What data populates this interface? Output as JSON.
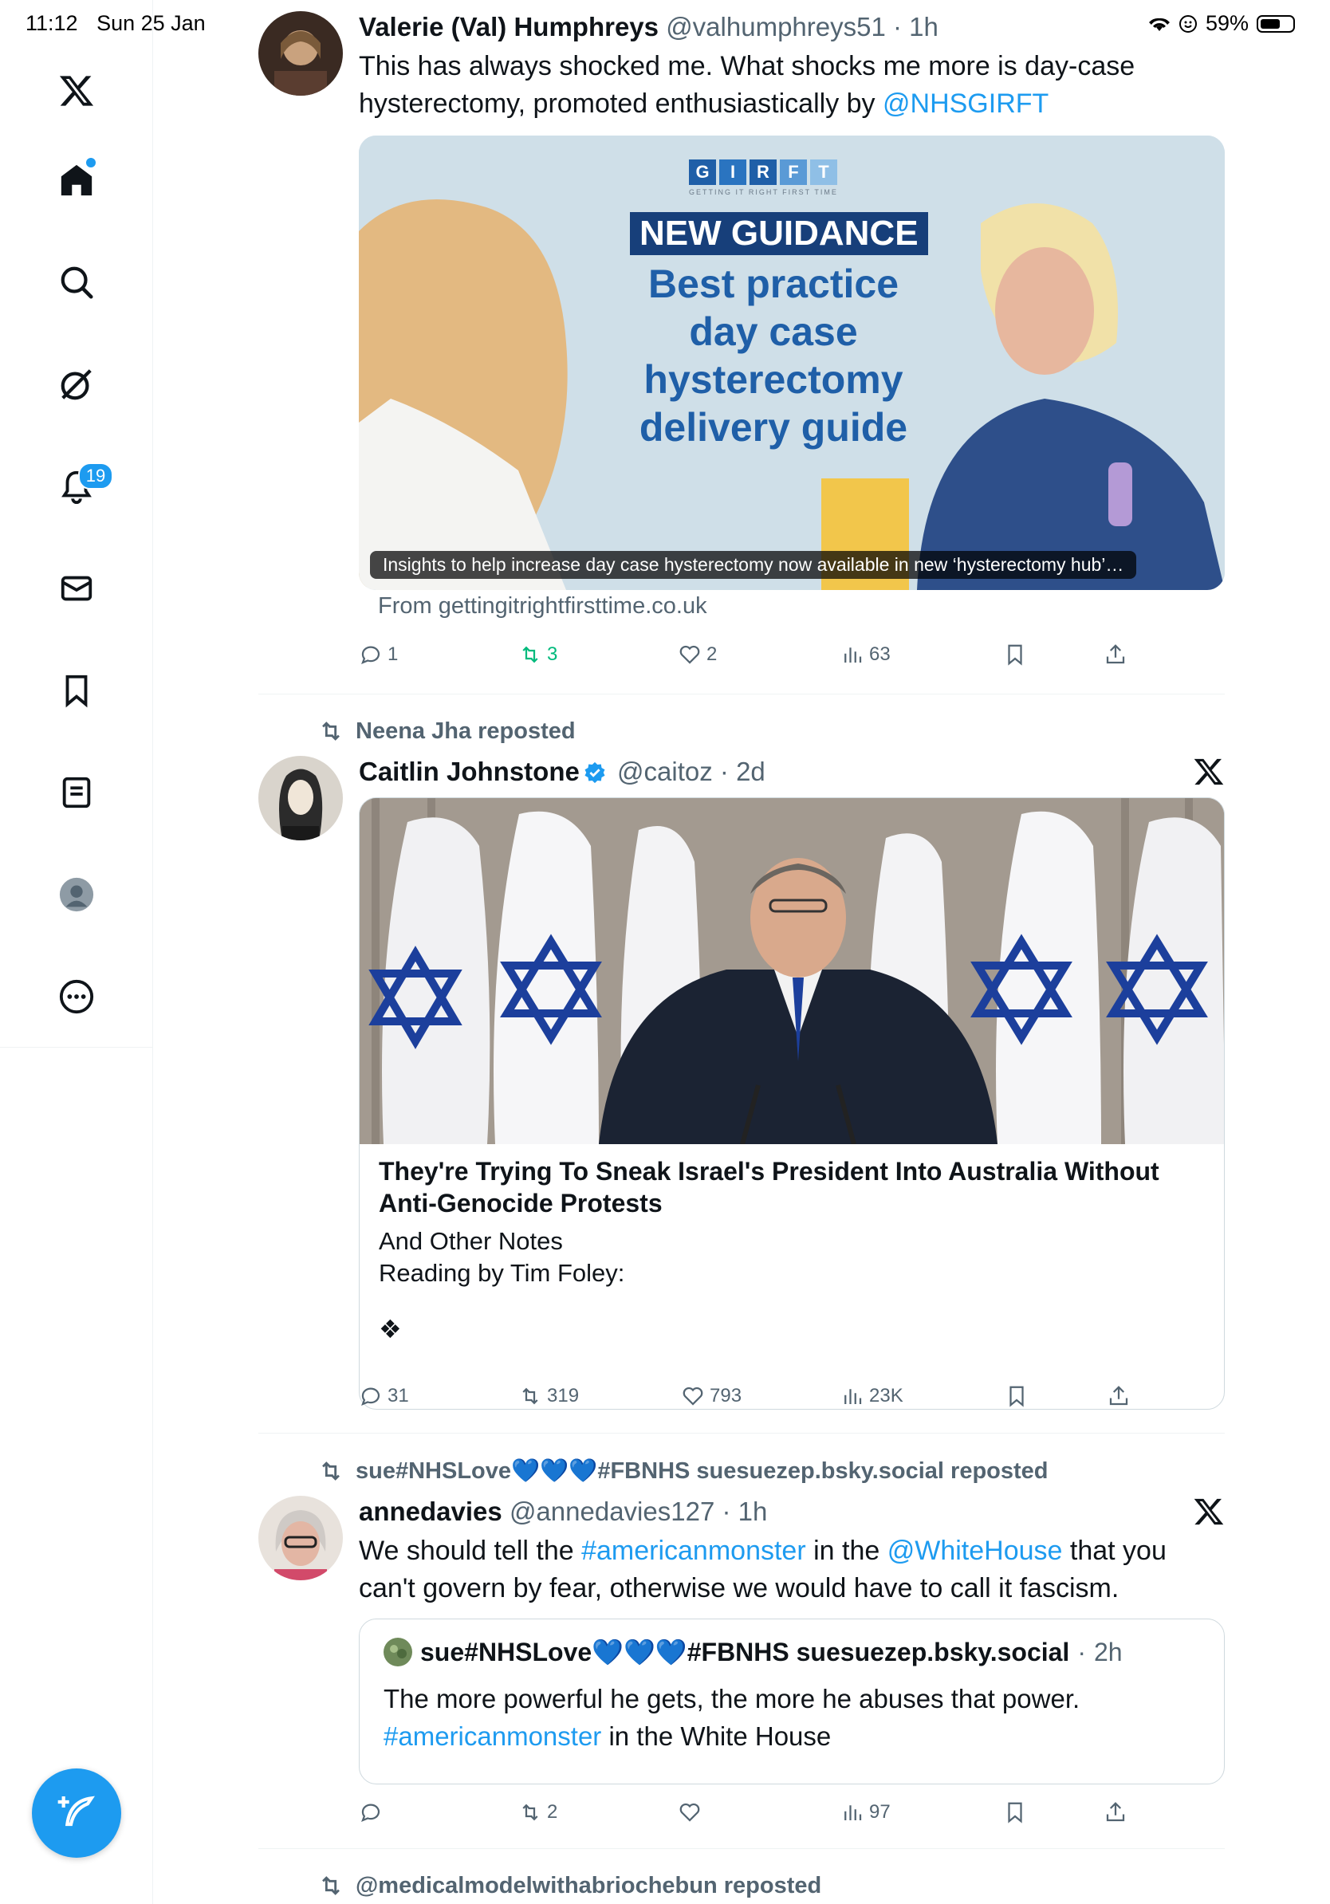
{
  "status": {
    "time": "11:12",
    "date": "Sun 25 Jan",
    "battery": "59%"
  },
  "sidebar": {
    "notifications_count": "19",
    "items": [
      "x-logo",
      "home",
      "explore",
      "grok",
      "notifications",
      "messages",
      "bookmarks",
      "lists",
      "profile",
      "more"
    ]
  },
  "tweet1": {
    "name": "Valerie (Val) Humphreys",
    "handle": "@valhumphreys51",
    "time": "1h",
    "text_a": "This has always shocked me. What shocks me more is day-case hysterectomy, promoted enthusiastically by ",
    "mention": "@NHSGIRFT",
    "card": {
      "logo_letters": [
        "G",
        "I",
        "R",
        "F",
        "T"
      ],
      "logo_tag": "GETTING IT RIGHT FIRST TIME",
      "banner": "NEW GUIDANCE",
      "headline_lines": [
        "Best practice",
        "day case",
        "hysterectomy",
        "delivery guide"
      ],
      "caption": "Insights to help increase day case hysterectomy now available in new ‘hysterectomy hub’…",
      "source": "From gettingitrightfirsttime.co.uk"
    },
    "replies": "1",
    "reposts": "3",
    "likes": "2",
    "views": "63"
  },
  "tweet2": {
    "reposted_by": "Neena Jha reposted",
    "name": "Caitlin Johnstone",
    "handle": "@caitoz",
    "time": "2d",
    "card_title": "They're Trying To Sneak Israel's President Into Australia Without Anti-Genocide Protests",
    "card_sub1": "And Other Notes",
    "card_sub2": "Reading by Tim Foley:",
    "card_glyph": "❖",
    "replies": "31",
    "reposts": "319",
    "likes": "793",
    "views": "23K"
  },
  "tweet3": {
    "reposted_by": "sue#NHSLove💙💙💙#FBNHS suesuezep.bsky.social reposted",
    "name": "annedavies",
    "handle": "@annedavies127",
    "time": "1h",
    "text_a": "We should tell the ",
    "tag1": "#americanmonster",
    "text_b": " in the ",
    "mention": "@WhiteHouse",
    "text_c": " that you can't govern by fear, otherwise we would have to call it fascism.",
    "quote": {
      "name": "sue#NHSLove💙💙💙#FBNHS suesuezep.bsky.social",
      "time": "2h",
      "text_a": "The more powerful he gets, the more he abuses that power.",
      "tag": "#americanmonster",
      "text_b": " in the White House"
    },
    "replies": "",
    "reposts": "2",
    "likes": "",
    "views": "97"
  },
  "tweet4": {
    "reposted_by": "@medicalmodelwithabriochebun reposted"
  },
  "colors": {
    "accent": "#1d9bf0",
    "repost_green": "#00ba7c",
    "muted": "#536471"
  }
}
